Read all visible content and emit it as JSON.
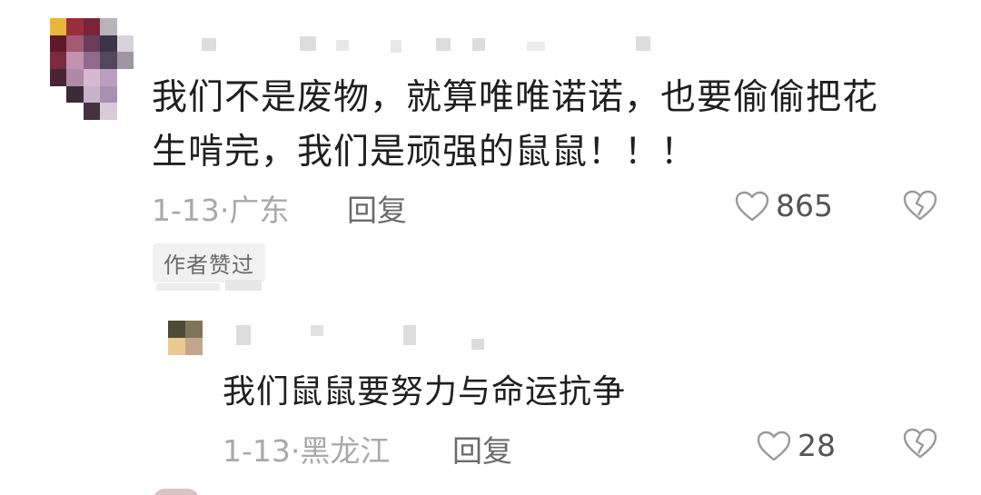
{
  "comment": {
    "text_line1": "我们不是废物，就算唯唯诺诺，也要偷偷把花",
    "text_line2": "生啃完，我们是顽强的鼠鼠！！！",
    "date": "1-13",
    "separator": "·",
    "location": "广东",
    "reply_label": "回复",
    "like_count": "865",
    "badge": "作者赞过"
  },
  "reply": {
    "text": "我们鼠鼠要努力与命运抗争",
    "date": "1-13",
    "separator": "·",
    "location": "黑龙江",
    "reply_label": "回复",
    "like_count": "28"
  },
  "icons": {
    "like": "heart-outline-icon",
    "dislike": "broken-heart-icon"
  }
}
